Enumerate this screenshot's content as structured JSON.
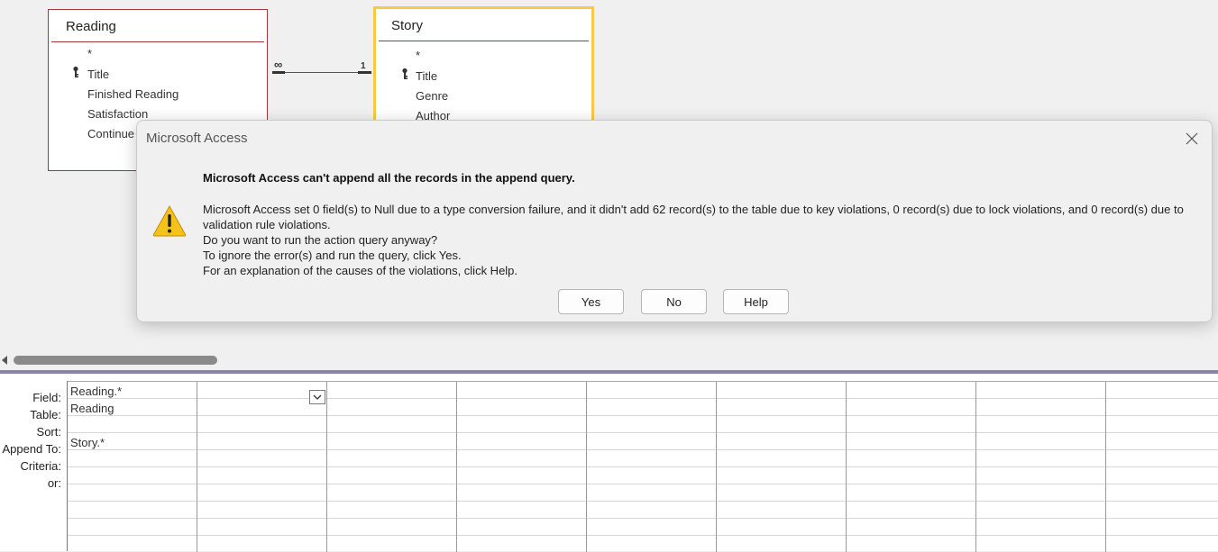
{
  "tables": [
    {
      "title": "Reading",
      "fields": [
        "*",
        "Title",
        "Finished Reading",
        "Satisfaction",
        "Continue"
      ],
      "key_field": "Title"
    },
    {
      "title": "Story",
      "fields": [
        "*",
        "Title",
        "Genre",
        "Author"
      ],
      "key_field": "Title"
    }
  ],
  "relationship": {
    "many_label": "∞",
    "one_label": "1"
  },
  "query_grid": {
    "row_labels": [
      "Field:",
      "Table:",
      "Sort:",
      "Append To:",
      "Criteria:",
      "or:"
    ],
    "column1": {
      "field": "Reading.*",
      "table": "Reading",
      "append_to": "Story.*"
    }
  },
  "dialog": {
    "title": "Microsoft Access",
    "heading": "Microsoft Access can't append all the records in the append query.",
    "message": "Microsoft Access set 0 field(s) to Null due to a type conversion failure, and it didn't add 62 record(s) to the table due to key violations, 0 record(s) due to lock violations, and 0 record(s) due to validation rule violations.",
    "question": "Do you want to run the action query anyway?",
    "line_ignore": "To ignore the error(s) and run the query, click Yes.",
    "line_help": "For an explanation of the causes of the violations, click Help.",
    "buttons": {
      "yes": "Yes",
      "no": "No",
      "help": "Help"
    },
    "icon": "warning-icon"
  },
  "colors": {
    "table_border": "#a4373a",
    "selected_border": "#f7c948",
    "warning_fill": "#f5c21b"
  }
}
